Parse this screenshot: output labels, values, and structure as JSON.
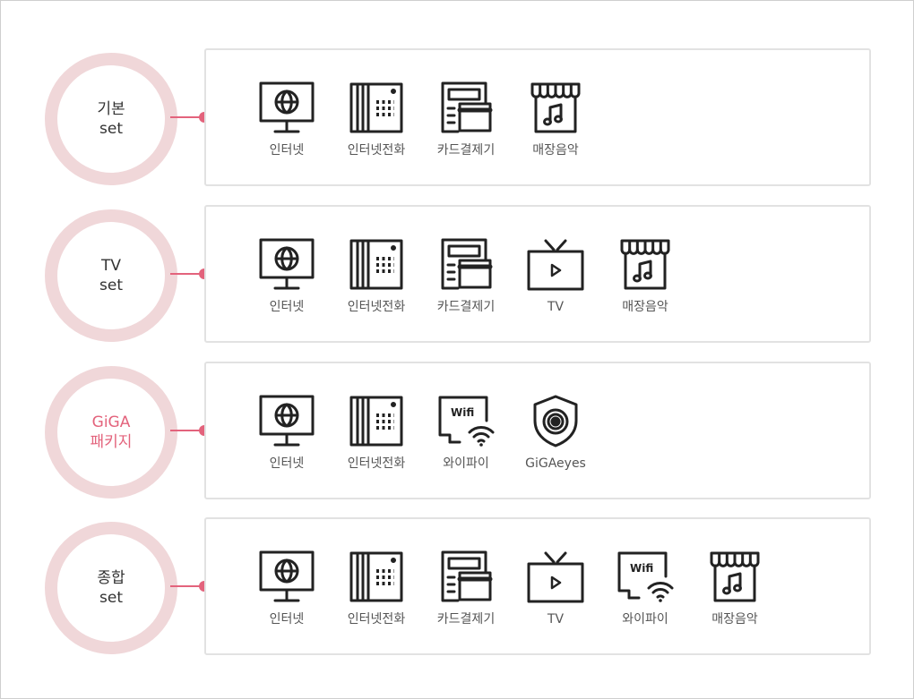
{
  "colors": {
    "accent": "#e3637c",
    "ring": "#f0d7d9",
    "panel_border": "#e2e2e2",
    "icon_stroke": "#222222",
    "label_text": "#555555"
  },
  "sets": [
    {
      "title_line1": "기본",
      "title_line2": "set",
      "highlight": false,
      "items": [
        {
          "icon": "monitor-globe-icon",
          "label": "인터넷"
        },
        {
          "icon": "desk-phone-icon",
          "label": "인터넷전화"
        },
        {
          "icon": "card-terminal-icon",
          "label": "카드결제기"
        },
        {
          "icon": "store-music-icon",
          "label": "매장음악"
        }
      ]
    },
    {
      "title_line1": "TV",
      "title_line2": "set",
      "highlight": false,
      "items": [
        {
          "icon": "monitor-globe-icon",
          "label": "인터넷"
        },
        {
          "icon": "desk-phone-icon",
          "label": "인터넷전화"
        },
        {
          "icon": "card-terminal-icon",
          "label": "카드결제기"
        },
        {
          "icon": "tv-play-icon",
          "label": "TV"
        },
        {
          "icon": "store-music-icon",
          "label": "매장음악"
        }
      ]
    },
    {
      "title_line1": "GiGA",
      "title_line2": "패키지",
      "highlight": true,
      "items": [
        {
          "icon": "monitor-globe-icon",
          "label": "인터넷"
        },
        {
          "icon": "desk-phone-icon",
          "label": "인터넷전화"
        },
        {
          "icon": "wifi-router-icon",
          "label": "와이파이",
          "badge": "Wifi"
        },
        {
          "icon": "camera-shield-icon",
          "label": "GiGAeyes"
        }
      ]
    },
    {
      "title_line1": "종합",
      "title_line2": "set",
      "highlight": false,
      "items": [
        {
          "icon": "monitor-globe-icon",
          "label": "인터넷"
        },
        {
          "icon": "desk-phone-icon",
          "label": "인터넷전화"
        },
        {
          "icon": "card-terminal-icon",
          "label": "카드결제기"
        },
        {
          "icon": "tv-play-icon",
          "label": "TV"
        },
        {
          "icon": "wifi-router-icon",
          "label": "와이파이",
          "badge": "Wifi"
        },
        {
          "icon": "store-music-icon",
          "label": "매장음악"
        }
      ]
    }
  ]
}
